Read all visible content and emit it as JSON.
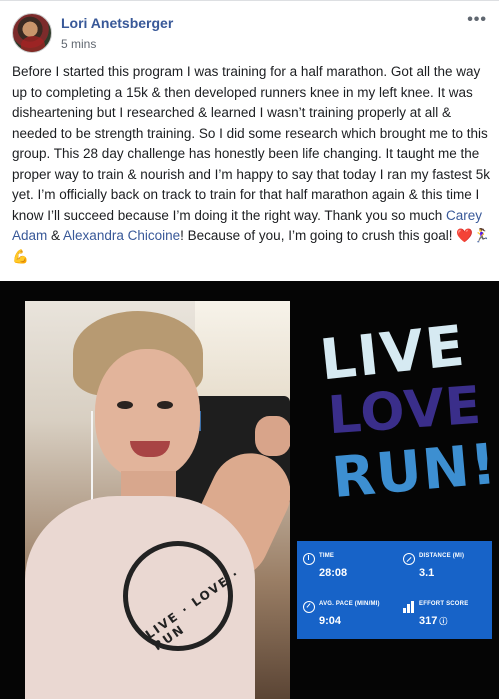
{
  "post": {
    "author": "Lori Anetsberger",
    "timestamp": "5 mins",
    "more_icon": "more-horizontal-icon",
    "text_before_mention1": "Before I started this program I was training for a half marathon. Got all the way up to completing a 15k & then developed runners knee in my left knee. It was disheartening but I researched & learned I wasn’t training properly at all & needed to be strength training. So I did some research which brought me to this group. This 28 day challenge has honestly been life changing. It taught me the proper way to train & nourish and I’m happy to say that today I ran my fastest 5k yet. I’m officially back on track to train for that half marathon again & this time I know I’ll succeed because I’m doing it the right way. Thank you so much ",
    "mention1": "Carey Adam",
    "text_between": " & ",
    "mention2": "Alexandra Chicoine",
    "text_after": "! Because of you, I’m going to crush this goal! ❤️🏃‍♀️💪"
  },
  "image": {
    "shirt_text": "LIVE · LOVE · RUN",
    "logo": {
      "line1": "LIVE",
      "line2": "LOVE",
      "line3": "RUN!"
    },
    "stats": {
      "time_label": "TIME",
      "time_value": "28:08",
      "distance_label": "DISTANCE (MI)",
      "distance_value": "3.1",
      "pace_label": "AVG. PACE (MIN/MI)",
      "pace_value": "9:04",
      "effort_label": "EFFORT SCORE",
      "effort_value": "317",
      "info_glyph": "ⓘ"
    }
  },
  "colors": {
    "link": "#385898",
    "stats_panel": "#1763c8"
  }
}
